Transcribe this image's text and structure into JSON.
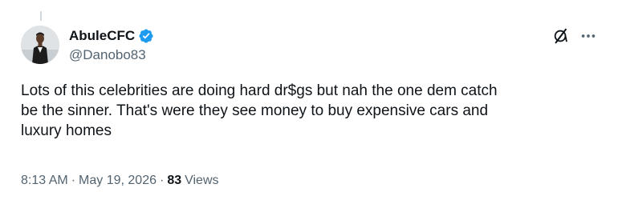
{
  "author": {
    "display_name": "AbuleCFC",
    "handle": "@Danobo83",
    "avatar_icon": "user-avatar-photo",
    "verified_icon": "verified-badge-icon",
    "verified_color": "#1d9bf0"
  },
  "actions": {
    "grok_icon": "grok-icon",
    "more_icon": "more-options-icon"
  },
  "tweet": {
    "text": "Lots of this celebrities are doing hard dr$gs but nah the one dem catch\nbe the sinner. That's were they see money to buy expensive cars and\nluxury homes"
  },
  "meta": {
    "time": "8:13 AM",
    "separator": "·",
    "date": "May 19, 2026",
    "views_count": "83",
    "views_label": "Views"
  },
  "colors": {
    "primary_text": "#0f1419",
    "secondary_text": "#536471",
    "thread_line": "#cfd9de"
  }
}
